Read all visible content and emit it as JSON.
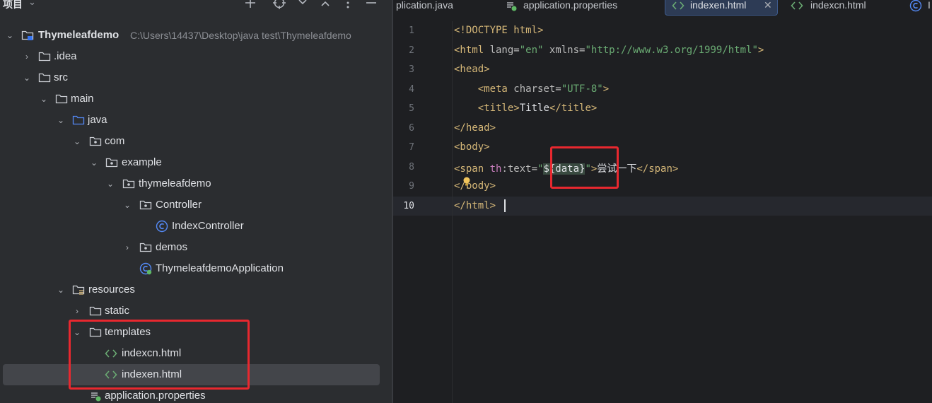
{
  "project_panel": {
    "title": "项目",
    "header_icons": [
      "add-icon",
      "locate-icon",
      "expand-all-icon",
      "collapse-all-icon",
      "more-icon",
      "minimize-icon"
    ],
    "root": {
      "label": "Thymeleafdemo",
      "path": "C:\\Users\\14437\\Desktop\\java test\\Thymeleafdemo"
    },
    "tree": [
      {
        "label": ".idea",
        "icon": "folder-icon",
        "expanded": false
      },
      {
        "label": "src",
        "icon": "folder-icon",
        "expanded": true
      },
      {
        "label": "main",
        "icon": "folder-icon",
        "expanded": true
      },
      {
        "label": "java",
        "icon": "source-folder-icon",
        "expanded": true
      },
      {
        "label": "com",
        "icon": "package-icon",
        "expanded": true
      },
      {
        "label": "example",
        "icon": "package-icon",
        "expanded": true
      },
      {
        "label": "thymeleafdemo",
        "icon": "package-icon",
        "expanded": true
      },
      {
        "label": "Controller",
        "icon": "package-icon",
        "expanded": true
      },
      {
        "label": "IndexController",
        "icon": "class-icon"
      },
      {
        "label": "demos",
        "icon": "package-icon",
        "expanded": false
      },
      {
        "label": "ThymeleafdemoApplication",
        "icon": "spring-app-class-icon"
      },
      {
        "label": "resources",
        "icon": "resources-folder-icon",
        "expanded": true
      },
      {
        "label": "static",
        "icon": "folder-icon",
        "expanded": false
      },
      {
        "label": "templates",
        "icon": "folder-icon",
        "expanded": true
      },
      {
        "label": "indexcn.html",
        "icon": "html-file-icon"
      },
      {
        "label": "indexen.html",
        "icon": "html-file-icon",
        "selected": true
      },
      {
        "label": "application.properties",
        "icon": "spring-properties-icon"
      }
    ]
  },
  "editor_tabs": [
    {
      "label": "plication.java",
      "icon": null,
      "active": false
    },
    {
      "label": "application.properties",
      "icon": "spring-properties-icon",
      "active": false
    },
    {
      "label": "indexen.html",
      "icon": "html-file-icon",
      "active": true,
      "closable": true
    },
    {
      "label": "indexcn.html",
      "icon": "html-file-icon",
      "active": false
    },
    {
      "label": "I",
      "icon": "class-icon",
      "active": false
    }
  ],
  "editor": {
    "current_line": 10,
    "line_numbers": [
      "1",
      "2",
      "3",
      "4",
      "5",
      "6",
      "7",
      "8",
      "9",
      "10"
    ],
    "lines": [
      {
        "segments": [
          [
            "tag",
            "<!DOCTYPE html>"
          ]
        ]
      },
      {
        "segments": [
          [
            "tag",
            "<html "
          ],
          [
            "attr",
            "lang="
          ],
          [
            "str",
            "\"en\""
          ],
          [
            "attr",
            " xmlns="
          ],
          [
            "str",
            "\"http://www.w3.org/1999/html\""
          ],
          [
            "tag",
            ">"
          ]
        ]
      },
      {
        "segments": [
          [
            "tag",
            "<head>"
          ]
        ]
      },
      {
        "segments": [
          [
            "txt",
            "    "
          ],
          [
            "tag",
            "<meta "
          ],
          [
            "attr",
            "charset="
          ],
          [
            "str",
            "\"UTF-8\""
          ],
          [
            "tag",
            ">"
          ]
        ]
      },
      {
        "segments": [
          [
            "txt",
            "    "
          ],
          [
            "tag",
            "<title>"
          ],
          [
            "txt",
            "Title"
          ],
          [
            "tag",
            "</title>"
          ]
        ]
      },
      {
        "segments": [
          [
            "tag",
            "</head>"
          ]
        ]
      },
      {
        "segments": [
          [
            "tag",
            "<body>"
          ]
        ]
      },
      {
        "segments": [
          [
            "tag",
            "<span "
          ],
          [
            "ns",
            "th"
          ],
          [
            "attr",
            ":text="
          ],
          [
            "str",
            "\""
          ],
          [
            "data",
            "${data}"
          ],
          [
            "str",
            "\""
          ],
          [
            "tag",
            ">"
          ],
          [
            "txt",
            "尝试一下"
          ],
          [
            "tag",
            "</span>"
          ]
        ]
      },
      {
        "segments": [
          [
            "tag",
            "</body>"
          ]
        ]
      },
      {
        "segments": [
          [
            "tag",
            "</html>"
          ]
        ]
      }
    ]
  },
  "colors": {
    "annotation_box": "#e8282f",
    "panel_bg": "#2b2d30",
    "editor_bg": "#1e1f22",
    "tag": "#d5b778",
    "string": "#6aab73",
    "namespace": "#c77dbb"
  }
}
